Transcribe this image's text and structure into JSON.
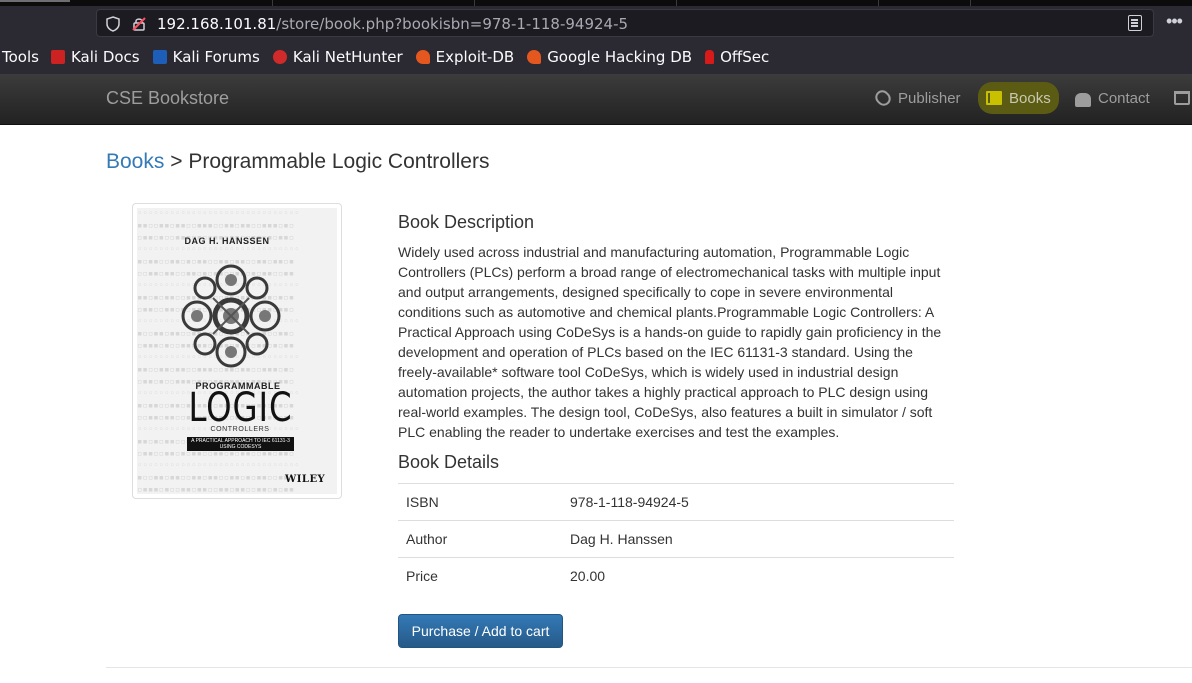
{
  "browser": {
    "url_host": "192.168.101.81",
    "url_path": "/store/book.php?bookisbn=978-1-118-94924-5",
    "bookmarks": [
      "Tools",
      "Kali Docs",
      "Kali Forums",
      "Kali NetHunter",
      "Exploit-DB",
      "Google Hacking DB",
      "OffSec"
    ]
  },
  "site": {
    "brand": "CSE Bookstore",
    "nav": {
      "publisher": "Publisher",
      "books": "Books",
      "contact": "Contact"
    }
  },
  "breadcrumb": {
    "link": "Books",
    "separator": ">",
    "current": "Programmable Logic Controllers"
  },
  "cover": {
    "author": "DAG H. HANSSEN",
    "line1": "PROGRAMMABLE",
    "line2": "LOGIC",
    "line3": "CONTROLLERS",
    "subtitle": "A PRACTICAL APPROACH TO IEC 61131-3 USING CODESYS",
    "publisher": "WILEY"
  },
  "book": {
    "description_heading": "Book Description",
    "description": "Widely used across industrial and manufacturing automation, Programmable Logic Controllers (PLCs) perform a broad range of electromechanical tasks with multiple input and output arrangements, designed specifically to cope in severe environmental conditions such as automotive and chemical plants.Programmable Logic Controllers: A Practical Approach using CoDeSys is a hands-on guide to rapidly gain proficiency in the development and operation of PLCs based on the IEC 61131-3 standard. Using the freely-available* software tool CoDeSys, which is widely used in industrial design automation projects, the author takes a highly practical approach to PLC design using real-world examples. The design tool, CoDeSys, also features a built in simulator / soft PLC enabling the reader to undertake exercises and test the examples.",
    "details_heading": "Book Details",
    "details": [
      {
        "label": "ISBN",
        "value": "978-1-118-94924-5"
      },
      {
        "label": "Author",
        "value": "Dag H. Hanssen"
      },
      {
        "label": "Price",
        "value": "20.00"
      }
    ],
    "purchase_label": "Purchase / Add to cart"
  }
}
